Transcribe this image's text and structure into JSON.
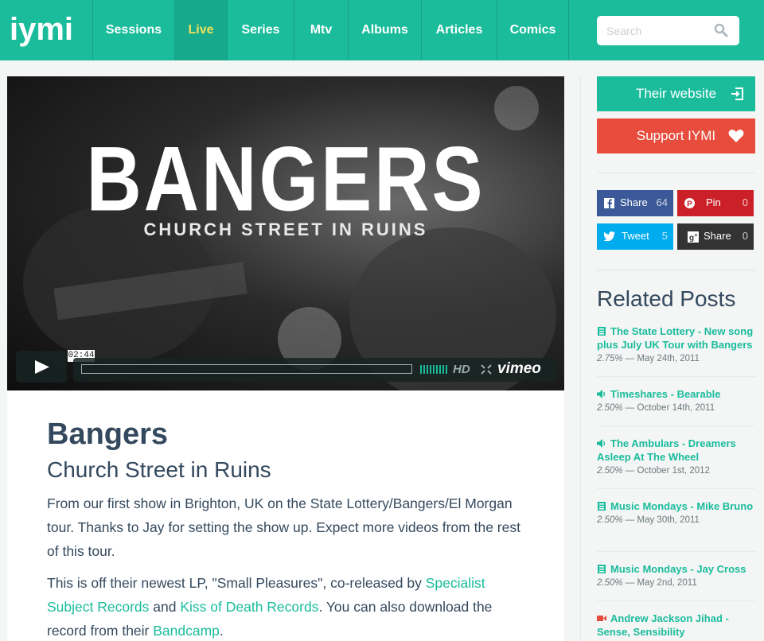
{
  "nav": {
    "logo": "iymi",
    "items": [
      {
        "label": "Sessions",
        "active": false
      },
      {
        "label": "Live",
        "active": true
      },
      {
        "label": "Series",
        "active": false
      },
      {
        "label": "Mtv",
        "active": false
      },
      {
        "label": "Albums",
        "active": false
      },
      {
        "label": "Articles",
        "active": false
      },
      {
        "label": "Comics",
        "active": false
      }
    ],
    "search_placeholder": "Search"
  },
  "video": {
    "title": "BANGERS",
    "subtitle": "CHURCH STREET IN RUINS",
    "time": "02:44",
    "hd": "HD",
    "brand": "vimeo"
  },
  "article": {
    "title": "Bangers",
    "subtitle": "Church Street in Ruins",
    "p1": "From our first show in Brighton, UK on the State Lottery/Bangers/El Morgan tour. Thanks to Jay for setting the show up. Expect more videos from the rest of this tour.",
    "p2_before": "This is off their newest LP, \"Small Pleasures\", co-released by ",
    "p2_link1": "Specialist Subject Records",
    "p2_and": " and ",
    "p2_link2": "Kiss of Death Records",
    "p2_mid": ". You can also download the record from their ",
    "p2_link3": "Bandcamp",
    "p2_end": "."
  },
  "sidebar": {
    "website_label": "Their website",
    "support_label": "Support IYMI",
    "share": [
      {
        "label": "Share",
        "count": "64",
        "color": "#3b5998"
      },
      {
        "label": "Pin",
        "count": "0",
        "color": "#cb2027"
      },
      {
        "label": "Tweet",
        "count": "5",
        "color": "#00aced"
      },
      {
        "label": "Share",
        "count": "0",
        "color": "#333333"
      }
    ],
    "related_title": "Related Posts",
    "related": [
      {
        "icon": "document-icon",
        "title": "The State Lottery - New song plus July UK Tour with Bangers",
        "score": "2.75%",
        "date": " — May 24th, 2011"
      },
      {
        "icon": "audio-icon",
        "title": "Timeshares - Bearable",
        "score": "2.50%",
        "date": " — October 14th, 2011"
      },
      {
        "icon": "audio-icon",
        "title": "The Ambulars - Dreamers Asleep At The Wheel",
        "score": "2.50%",
        "date": " — October 1st, 2012"
      },
      {
        "icon": "document-icon",
        "title": "Music Mondays - Mike Bruno",
        "score": "2.50%",
        "date": " — May 30th, 2011"
      },
      {
        "icon": "document-icon",
        "title": "Music Mondays - Jay Cross",
        "score": "2.50%",
        "date": " — May 2nd, 2011"
      },
      {
        "icon": "video-icon",
        "title": "Andrew Jackson Jihad - Sense, Sensibility",
        "score": "",
        "date": ""
      }
    ]
  },
  "colors": {
    "primary": "#1abc9c",
    "support": "#e74c3c",
    "text": "#34495e"
  }
}
